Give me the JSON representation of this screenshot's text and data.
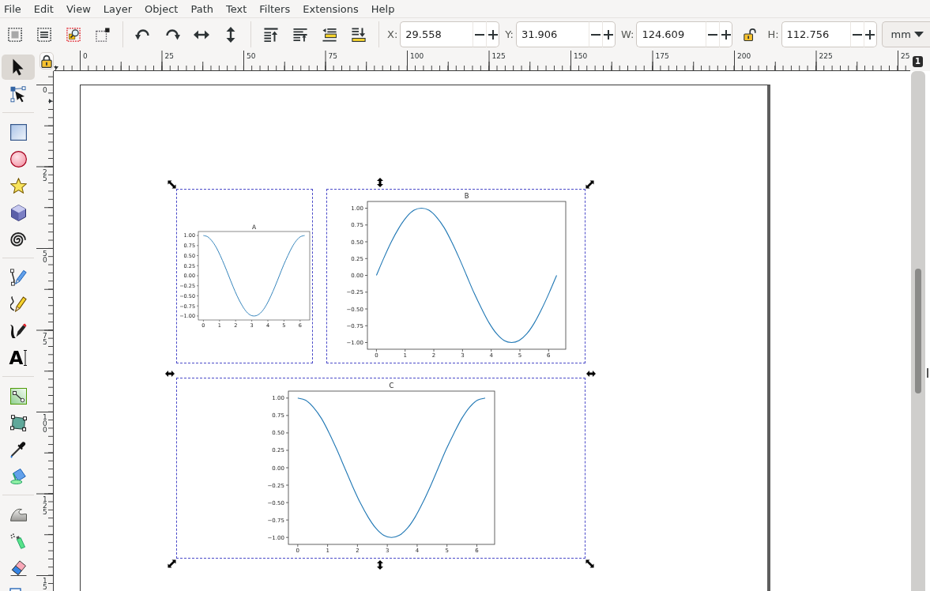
{
  "menu": [
    "File",
    "Edit",
    "View",
    "Layer",
    "Object",
    "Path",
    "Text",
    "Filters",
    "Extensions",
    "Help"
  ],
  "toolbar": {
    "groups": [
      [
        {
          "kind": "selectall"
        },
        {
          "kind": "selectlayers"
        },
        {
          "kind": "selectsame"
        },
        {
          "kind": "deselect"
        }
      ],
      [
        {
          "kind": "rotateccw"
        },
        {
          "kind": "rotatecw"
        },
        {
          "kind": "fliph"
        },
        {
          "kind": "flipv"
        }
      ],
      [
        {
          "kind": "top"
        },
        {
          "kind": "raise"
        },
        {
          "kind": "lower"
        },
        {
          "kind": "bottom"
        }
      ]
    ],
    "fields": [
      {
        "label": "X:",
        "value": "29.558"
      },
      {
        "label": "Y:",
        "value": "31.906"
      },
      {
        "label": "W:",
        "value": "124.609"
      },
      {
        "label": "H:",
        "value": "112.756"
      }
    ],
    "ratio_locked": false,
    "unit": "mm"
  },
  "toolbox": [
    [
      {
        "kind": "selector",
        "selected": true
      },
      {
        "kind": "node",
        "selected": false
      }
    ],
    [
      {
        "kind": "rect",
        "selected": false
      },
      {
        "kind": "ellipse",
        "selected": false
      },
      {
        "kind": "star",
        "selected": false
      },
      {
        "kind": "box3d",
        "selected": false
      },
      {
        "kind": "spiral",
        "selected": false
      }
    ],
    [
      {
        "kind": "pen",
        "selected": false
      },
      {
        "kind": "pencil",
        "selected": false
      },
      {
        "kind": "calligraphy",
        "selected": false
      },
      {
        "kind": "text",
        "selected": false,
        "glyph": "A"
      }
    ],
    [
      {
        "kind": "gradient",
        "selected": false
      },
      {
        "kind": "mesh",
        "selected": false
      },
      {
        "kind": "dropper",
        "selected": false
      },
      {
        "kind": "bucket",
        "selected": false
      }
    ],
    [
      {
        "kind": "tweak",
        "selected": false
      },
      {
        "kind": "spray",
        "selected": false
      },
      {
        "kind": "eraser",
        "selected": false
      },
      {
        "kind": "connector",
        "selected": false
      }
    ]
  ],
  "rulers": {
    "guides_locked": true,
    "horizontal": [
      "0",
      "25",
      "50",
      "75",
      "100",
      "125",
      "150",
      "175",
      "200",
      "225",
      "25"
    ],
    "vertical": [
      "0",
      "25",
      "50",
      "75",
      "100",
      "125",
      "15"
    ]
  },
  "page_badge": "1",
  "canvas": {
    "figures": [
      {
        "selected": true,
        "chart_data": {
          "type": "line",
          "title": "A",
          "x": [
            0,
            0.26,
            0.52,
            0.79,
            1.05,
            1.31,
            1.57,
            1.83,
            2.09,
            2.36,
            2.62,
            2.88,
            3.14,
            3.4,
            3.67,
            3.93,
            4.19,
            4.45,
            4.71,
            4.97,
            5.24,
            5.5,
            5.76,
            6.02,
            6.28
          ],
          "series": [
            {
              "color": "#1f77b4",
              "values": [
                1,
                0.97,
                0.87,
                0.71,
                0.5,
                0.26,
                0,
                -0.26,
                -0.5,
                -0.71,
                -0.87,
                -0.97,
                -1,
                -0.97,
                -0.87,
                -0.71,
                -0.5,
                -0.26,
                0,
                0.26,
                0.5,
                0.71,
                0.87,
                0.97,
                1
              ]
            }
          ],
          "xlim": [
            -0.314,
            6.597
          ],
          "ylim": [
            -1.1,
            1.1
          ],
          "xticks": [
            0,
            1,
            2,
            3,
            4,
            5,
            6
          ],
          "yticks": [
            {
              "value": 1,
              "label": "1.00"
            },
            {
              "value": 0.75,
              "label": "0.75"
            },
            {
              "value": 0.5,
              "label": "0.50"
            },
            {
              "value": 0.25,
              "label": "0.25"
            },
            {
              "value": 0,
              "label": "0.00"
            },
            {
              "value": -0.25,
              "label": "−0.25"
            },
            {
              "value": -0.5,
              "label": "−0.50"
            },
            {
              "value": -0.75,
              "label": "−0.75"
            },
            {
              "value": -1,
              "label": "−1.00"
            }
          ]
        }
      },
      {
        "selected": true,
        "chart_data": {
          "type": "line",
          "title": "B",
          "x": [
            0,
            0.26,
            0.52,
            0.79,
            1.05,
            1.31,
            1.57,
            1.83,
            2.09,
            2.36,
            2.62,
            2.88,
            3.14,
            3.4,
            3.67,
            3.93,
            4.19,
            4.45,
            4.71,
            4.97,
            5.24,
            5.5,
            5.76,
            6.02,
            6.28
          ],
          "series": [
            {
              "color": "#1f77b4",
              "values": [
                0,
                0.26,
                0.5,
                0.71,
                0.87,
                0.97,
                1,
                0.97,
                0.87,
                0.71,
                0.5,
                0.26,
                0,
                -0.26,
                -0.5,
                -0.71,
                -0.87,
                -0.97,
                -1,
                -0.97,
                -0.87,
                -0.71,
                -0.5,
                -0.26,
                0
              ]
            }
          ],
          "xlim": [
            -0.314,
            6.597
          ],
          "ylim": [
            -1.1,
            1.1
          ],
          "xticks": [
            0,
            1,
            2,
            3,
            4,
            5,
            6
          ],
          "yticks": [
            {
              "value": 1,
              "label": "1.00"
            },
            {
              "value": 0.75,
              "label": "0.75"
            },
            {
              "value": 0.5,
              "label": "0.50"
            },
            {
              "value": 0.25,
              "label": "0.25"
            },
            {
              "value": 0,
              "label": "0.00"
            },
            {
              "value": -0.25,
              "label": "−0.25"
            },
            {
              "value": -0.5,
              "label": "−0.50"
            },
            {
              "value": -0.75,
              "label": "−0.75"
            },
            {
              "value": -1,
              "label": "−1.00"
            }
          ]
        }
      },
      {
        "selected": true,
        "chart_data": {
          "type": "line",
          "title": "C",
          "x": [
            0,
            0.26,
            0.52,
            0.79,
            1.05,
            1.31,
            1.57,
            1.83,
            2.09,
            2.36,
            2.62,
            2.88,
            3.14,
            3.4,
            3.67,
            3.93,
            4.19,
            4.45,
            4.71,
            4.97,
            5.24,
            5.5,
            5.76,
            6.02,
            6.28
          ],
          "series": [
            {
              "color": "#1f77b4",
              "values": [
                1,
                0.97,
                0.87,
                0.71,
                0.5,
                0.26,
                0,
                -0.26,
                -0.5,
                -0.71,
                -0.87,
                -0.97,
                -1,
                -0.97,
                -0.87,
                -0.71,
                -0.5,
                -0.26,
                0,
                0.26,
                0.5,
                0.71,
                0.87,
                0.97,
                1
              ]
            }
          ],
          "xlim": [
            -0.314,
            6.597
          ],
          "ylim": [
            -1.1,
            1.1
          ],
          "xticks": [
            0,
            1,
            2,
            3,
            4,
            5,
            6
          ],
          "yticks": [
            {
              "value": 1,
              "label": "1.00"
            },
            {
              "value": 0.75,
              "label": "0.75"
            },
            {
              "value": 0.5,
              "label": "0.50"
            },
            {
              "value": 0.25,
              "label": "0.25"
            },
            {
              "value": 0,
              "label": "0.00"
            },
            {
              "value": -0.25,
              "label": "−0.25"
            },
            {
              "value": -0.5,
              "label": "−0.50"
            },
            {
              "value": -0.75,
              "label": "−0.75"
            },
            {
              "value": -1,
              "label": "−1.00"
            }
          ]
        }
      }
    ]
  }
}
